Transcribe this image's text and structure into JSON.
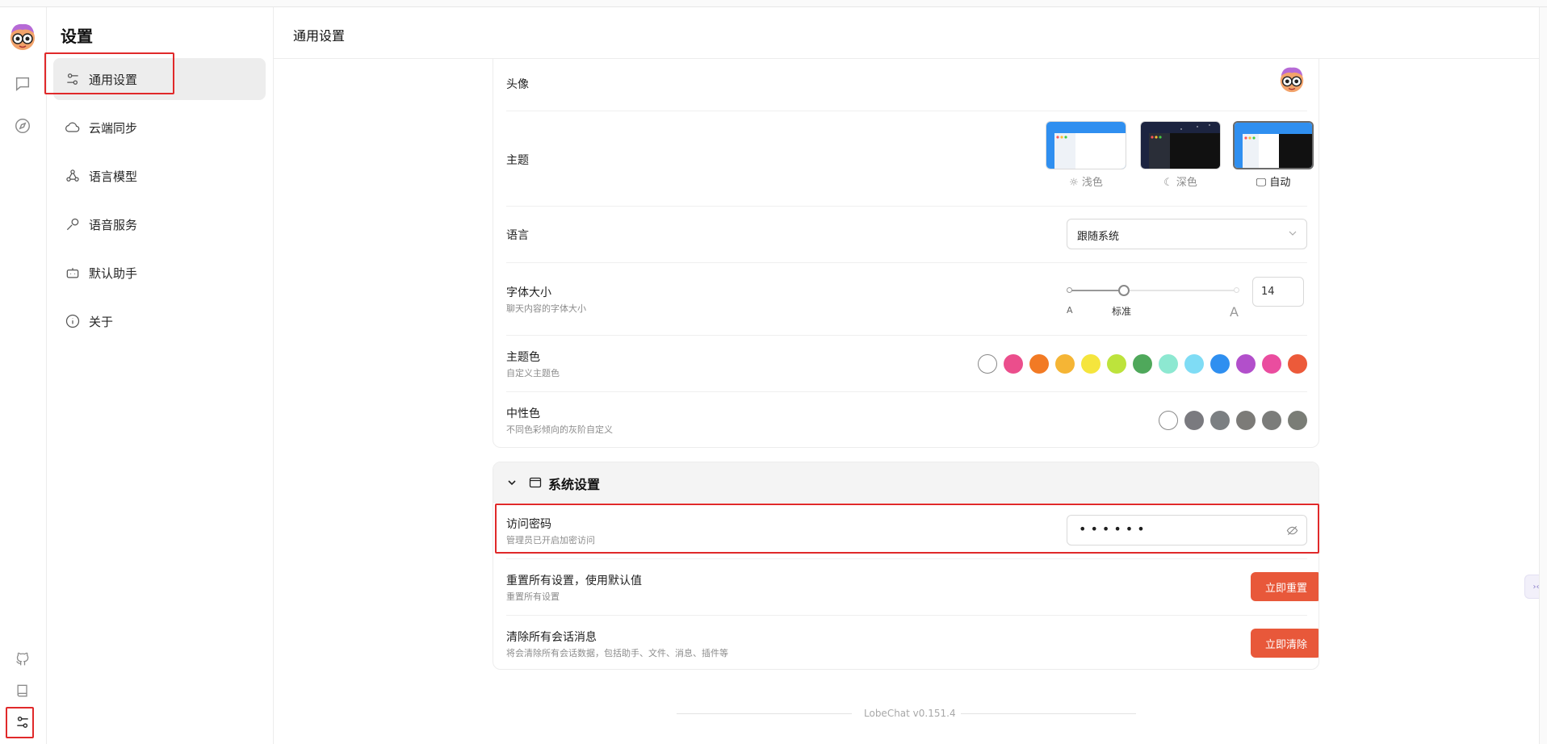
{
  "settings_title": "设置",
  "nav": [
    {
      "label": "通用设置",
      "icon": "sliders-icon"
    },
    {
      "label": "云端同步",
      "icon": "cloud-icon"
    },
    {
      "label": "语言模型",
      "icon": "webhook-icon"
    },
    {
      "label": "语音服务",
      "icon": "mic-icon"
    },
    {
      "label": "默认助手",
      "icon": "bot-icon"
    },
    {
      "label": "关于",
      "icon": "info-icon"
    }
  ],
  "header_title": "通用设置",
  "common": {
    "avatar_label": "头像",
    "theme_label": "主题",
    "theme_options": [
      "浅色",
      "深色",
      "自动"
    ],
    "theme_selected": "自动",
    "language_label": "语言",
    "language_value": "跟随系统",
    "font_label": "字体大小",
    "font_desc": "聊天内容的字体大小",
    "font_small": "A",
    "font_mid": "标准",
    "font_large": "A",
    "font_value": "14",
    "font_slider_fraction": 0.33,
    "primary_label": "主题色",
    "primary_desc": "自定义主题色",
    "primary_colors": [
      "#ffffff",
      "#eb4e8c",
      "#f27a24",
      "#f5b535",
      "#f5e53d",
      "#bde33c",
      "#4fa85b",
      "#8de8d1",
      "#7fdcf5",
      "#2f8ff0",
      "#b24fcb",
      "#ea4d9f",
      "#ec5a3a"
    ],
    "neutral_label": "中性色",
    "neutral_desc": "不同色彩倾向的灰阶自定义",
    "neutral_colors": [
      "#ffffff",
      "#7a7a7f",
      "#7b7f82",
      "#7c7b78",
      "#7b7c7a",
      "#7a7d76"
    ]
  },
  "system": {
    "title": "系统设置",
    "password_label": "访问密码",
    "password_desc": "管理员已开启加密访问",
    "password_value": "••••••",
    "reset_label": "重置所有设置，使用默认值",
    "reset_desc": "重置所有设置",
    "reset_button": "立即重置",
    "clear_label": "清除所有会话消息",
    "clear_desc": "将会清除所有会话数据，包括助手、文件、消息、插件等",
    "clear_button": "立即清除"
  },
  "footer_version": "LobeChat v0.151.4",
  "colors": {
    "accent_red": "#e8583a",
    "highlight_box": "#e0292a"
  }
}
